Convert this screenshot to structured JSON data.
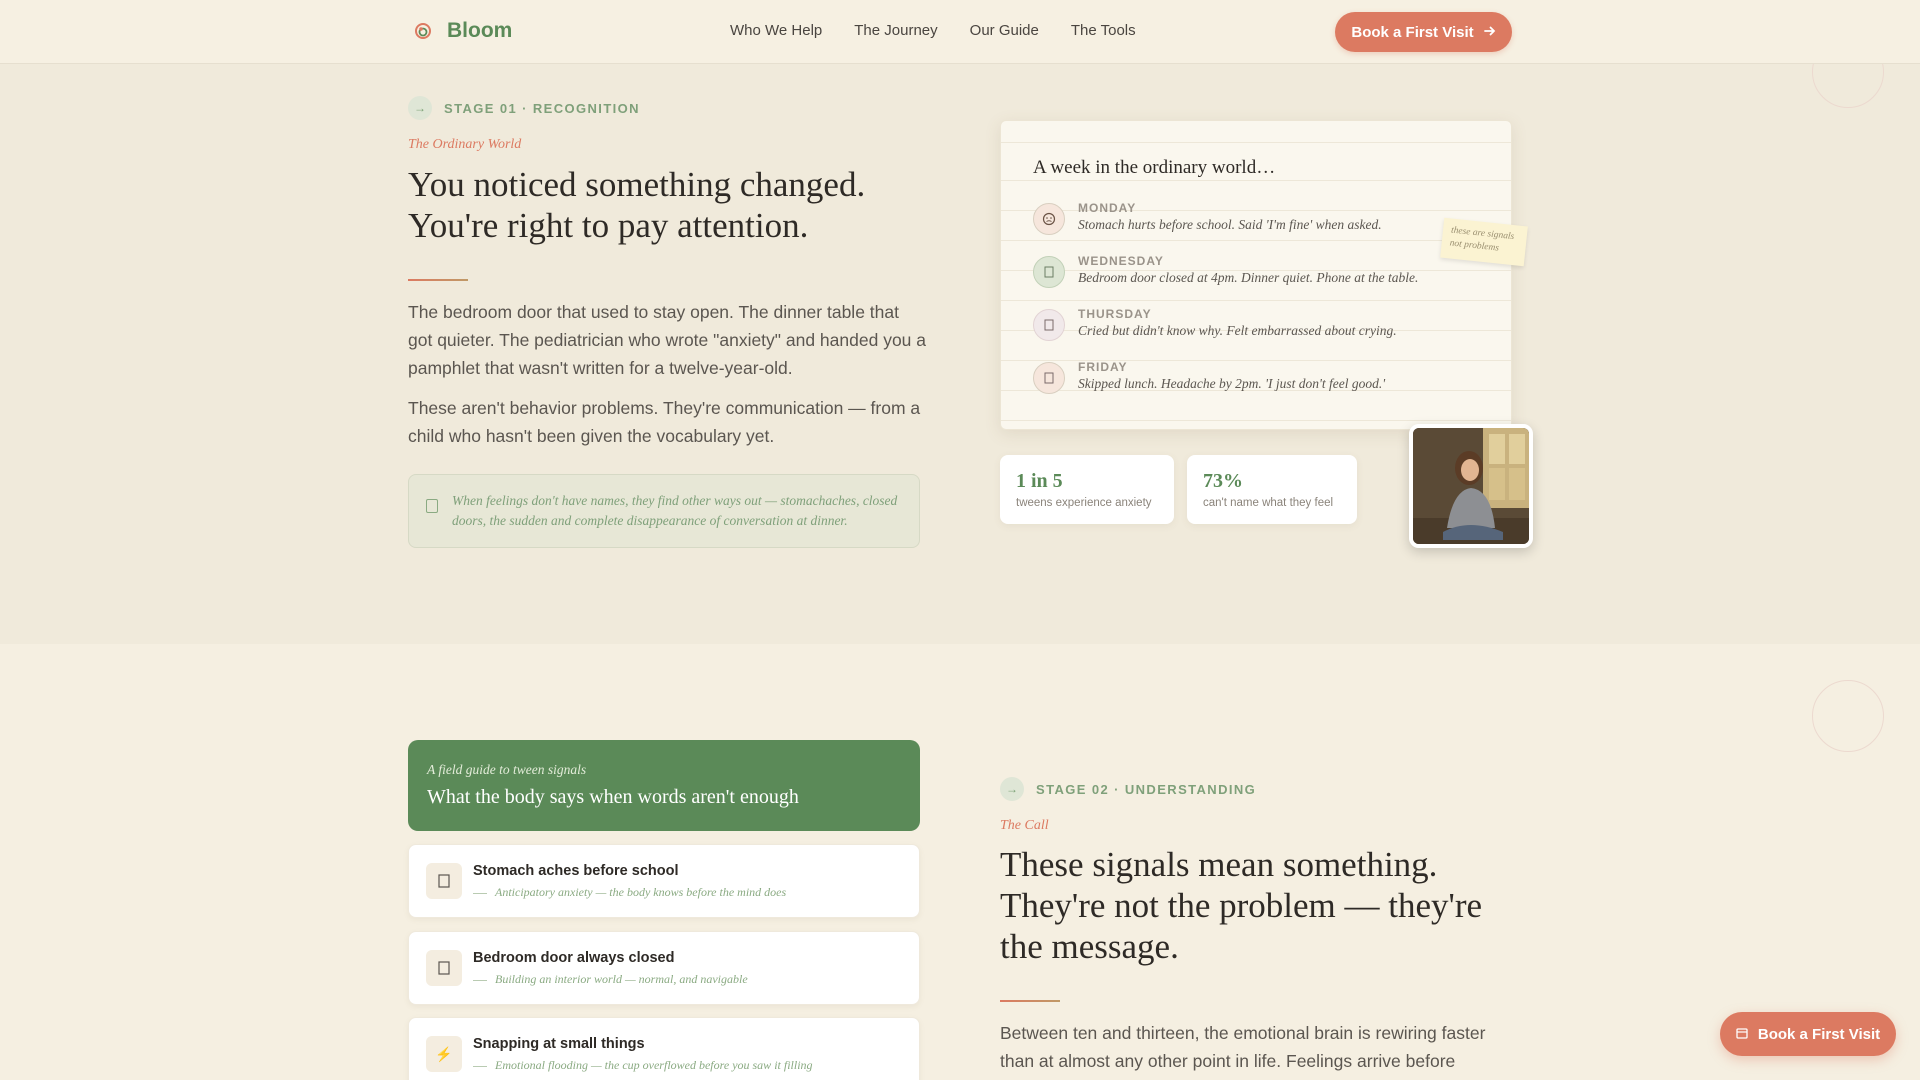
{
  "brand": {
    "name": "Bloom",
    "accent": "#5b8a58",
    "cta_color": "#dc7a61"
  },
  "nav": {
    "links": [
      "Who We Help",
      "The Journey",
      "Our Guide",
      "The Tools"
    ],
    "cta": "Book a First Visit"
  },
  "stage1": {
    "label": "STAGE 01 · RECOGNITION",
    "kicker": "The Ordinary World",
    "title_line1": "You noticed something changed.",
    "title_line2": "You're right to pay attention.",
    "para1": "The bedroom door that used to stay open. The dinner table that got quieter. The pediatrician who wrote \"anxiety\" and handed you a pamphlet that wasn't written for a twelve-year-old.",
    "para2": "These aren't behavior problems. They're communication — from a child who hasn't been given the vocabulary yet.",
    "quote": "When feelings don't have names, they find other ways out — stomachaches, closed doors, the sudden and complete disappearance of conversation at dinner."
  },
  "diary": {
    "title": "A week in the ordinary world…",
    "days": [
      {
        "name": "MONDAY",
        "note": "Stomach hurts before school. Said 'I'm fine' when asked.",
        "icon": "face-icon"
      },
      {
        "name": "WEDNESDAY",
        "note": "Bedroom door closed at 4pm. Dinner quiet. Phone at the table.",
        "icon": "door-icon"
      },
      {
        "name": "THURSDAY",
        "note": "Cried but didn't know why. Felt embarrassed about crying.",
        "icon": "tear-icon"
      },
      {
        "name": "FRIDAY",
        "note": "Skipped lunch. Headache by 2pm. 'I just don't feel good.'",
        "icon": "plate-icon"
      }
    ],
    "sticky_note": "these are signals not problems"
  },
  "stats": [
    {
      "value": "1 in 5",
      "label": "tweens experience anxiety"
    },
    {
      "value": "73%",
      "label": "can't name what they feel"
    }
  ],
  "field_guide": {
    "subtitle": "A field guide to tween signals",
    "title": "What the body says when words aren't enough",
    "signals": [
      {
        "title": "Stomach aches before school",
        "desc": "Anticipatory anxiety — the body knows before the mind does",
        "icon": "stomach-icon"
      },
      {
        "title": "Bedroom door always closed",
        "desc": "Building an interior world — normal, and navigable",
        "icon": "door-icon"
      },
      {
        "title": "Snapping at small things",
        "desc": "Emotional flooding — the cup overflowed before you saw it filling",
        "icon": "lightning-icon"
      }
    ]
  },
  "stage2": {
    "label": "STAGE 02 · UNDERSTANDING",
    "kicker": "The Call",
    "title_line1": "These signals mean something.",
    "title_line2": "They're not the problem — they're",
    "title_line3": "the message.",
    "para": "Between ten and thirteen, the emotional brain is rewiring faster than at almost any other point in life. Feelings arrive before"
  },
  "floating_cta": "Book a First Visit"
}
